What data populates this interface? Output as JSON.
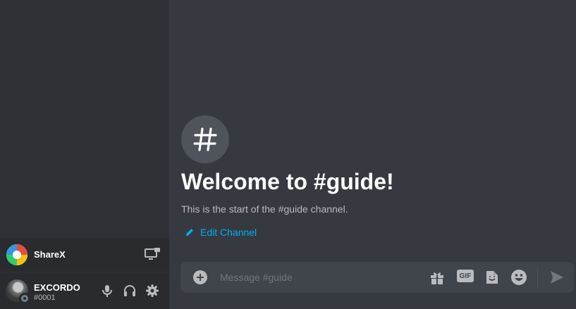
{
  "activity": {
    "app_name": "ShareX"
  },
  "user": {
    "name": "EXCORDO",
    "tag": "#0001"
  },
  "channel": {
    "welcome_title": "Welcome to #guide!",
    "description": "This is the start of the #guide channel.",
    "edit_label": "Edit Channel",
    "hash_symbol": "#"
  },
  "composer": {
    "placeholder": "Message #guide",
    "gif_label": "GIF"
  },
  "colors": {
    "sidebar": "#2f3136",
    "panel": "#292b2f",
    "main": "#36393f",
    "composer": "#40444b",
    "link": "#00aff4"
  }
}
